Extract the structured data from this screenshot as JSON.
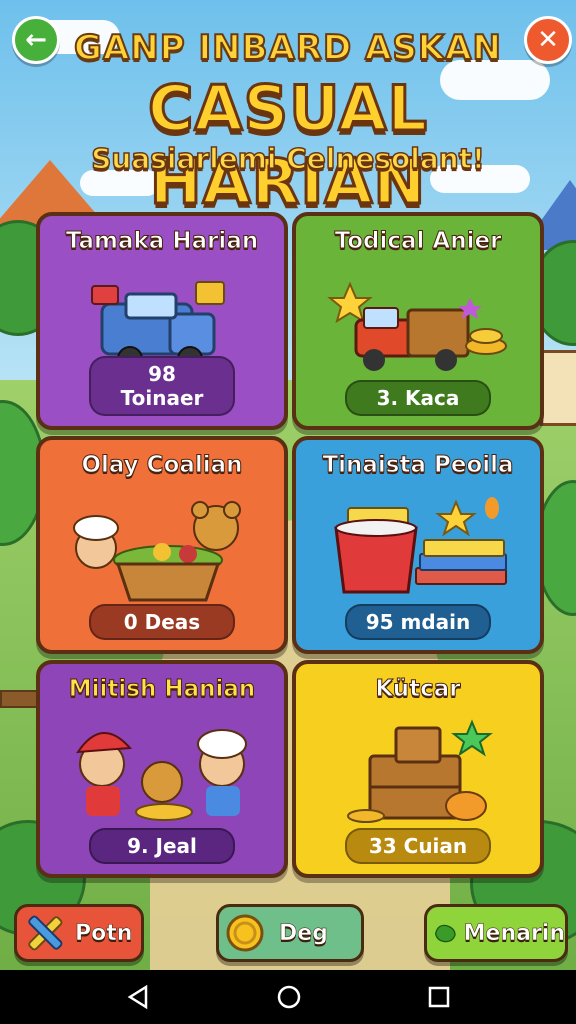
{
  "header": {
    "top_line": "GANP INBARD ASKAN",
    "main_title": "CASUAL HARIAN",
    "subtitle": "Suasiarlemi Celnesolant!",
    "back_icon": "arrow-left-icon",
    "close_icon": "close-icon"
  },
  "cards": [
    {
      "title": "Tamaka Harian",
      "value": "98 Toinaer",
      "color": "#9b4fc4",
      "pill_color": "#6a2f8f",
      "icon": "blue-truck-icon"
    },
    {
      "title": "Todical Anier",
      "value": "3. Kaca",
      "color": "#6bb43a",
      "pill_color": "#3f7a1f",
      "icon": "red-truck-icon"
    },
    {
      "title": "Olay Coalian",
      "value": "0 Deas",
      "color": "#f0703a",
      "pill_color": "#9a3a22",
      "icon": "food-basket-icon"
    },
    {
      "title": "Tinaista Peoila",
      "value": "95 mdain",
      "color": "#3aa0dc",
      "pill_color": "#1f5f92",
      "icon": "bucket-books-icon"
    },
    {
      "title": "Miitish Hanian",
      "value": "9. Jeal",
      "color": "#8d45b8",
      "pill_color": "#5a2680",
      "icon": "characters-icon"
    },
    {
      "title": "Kütcar",
      "value": "33 Cuian",
      "color": "#f7cf1e",
      "pill_color": "#b88a10",
      "icon": "treasure-crate-icon"
    }
  ],
  "bottom_bar": {
    "left_label": "Potn",
    "left_icon": "crossed-tools-icon",
    "center_label": "Deg",
    "center_icon": "coin-icon",
    "right_label": "Menarin",
    "right_icon": "leaf-icon"
  },
  "system_nav": {
    "back_icon": "triangle-back-icon",
    "home_icon": "circle-home-icon",
    "recents_icon": "square-recents-icon"
  }
}
